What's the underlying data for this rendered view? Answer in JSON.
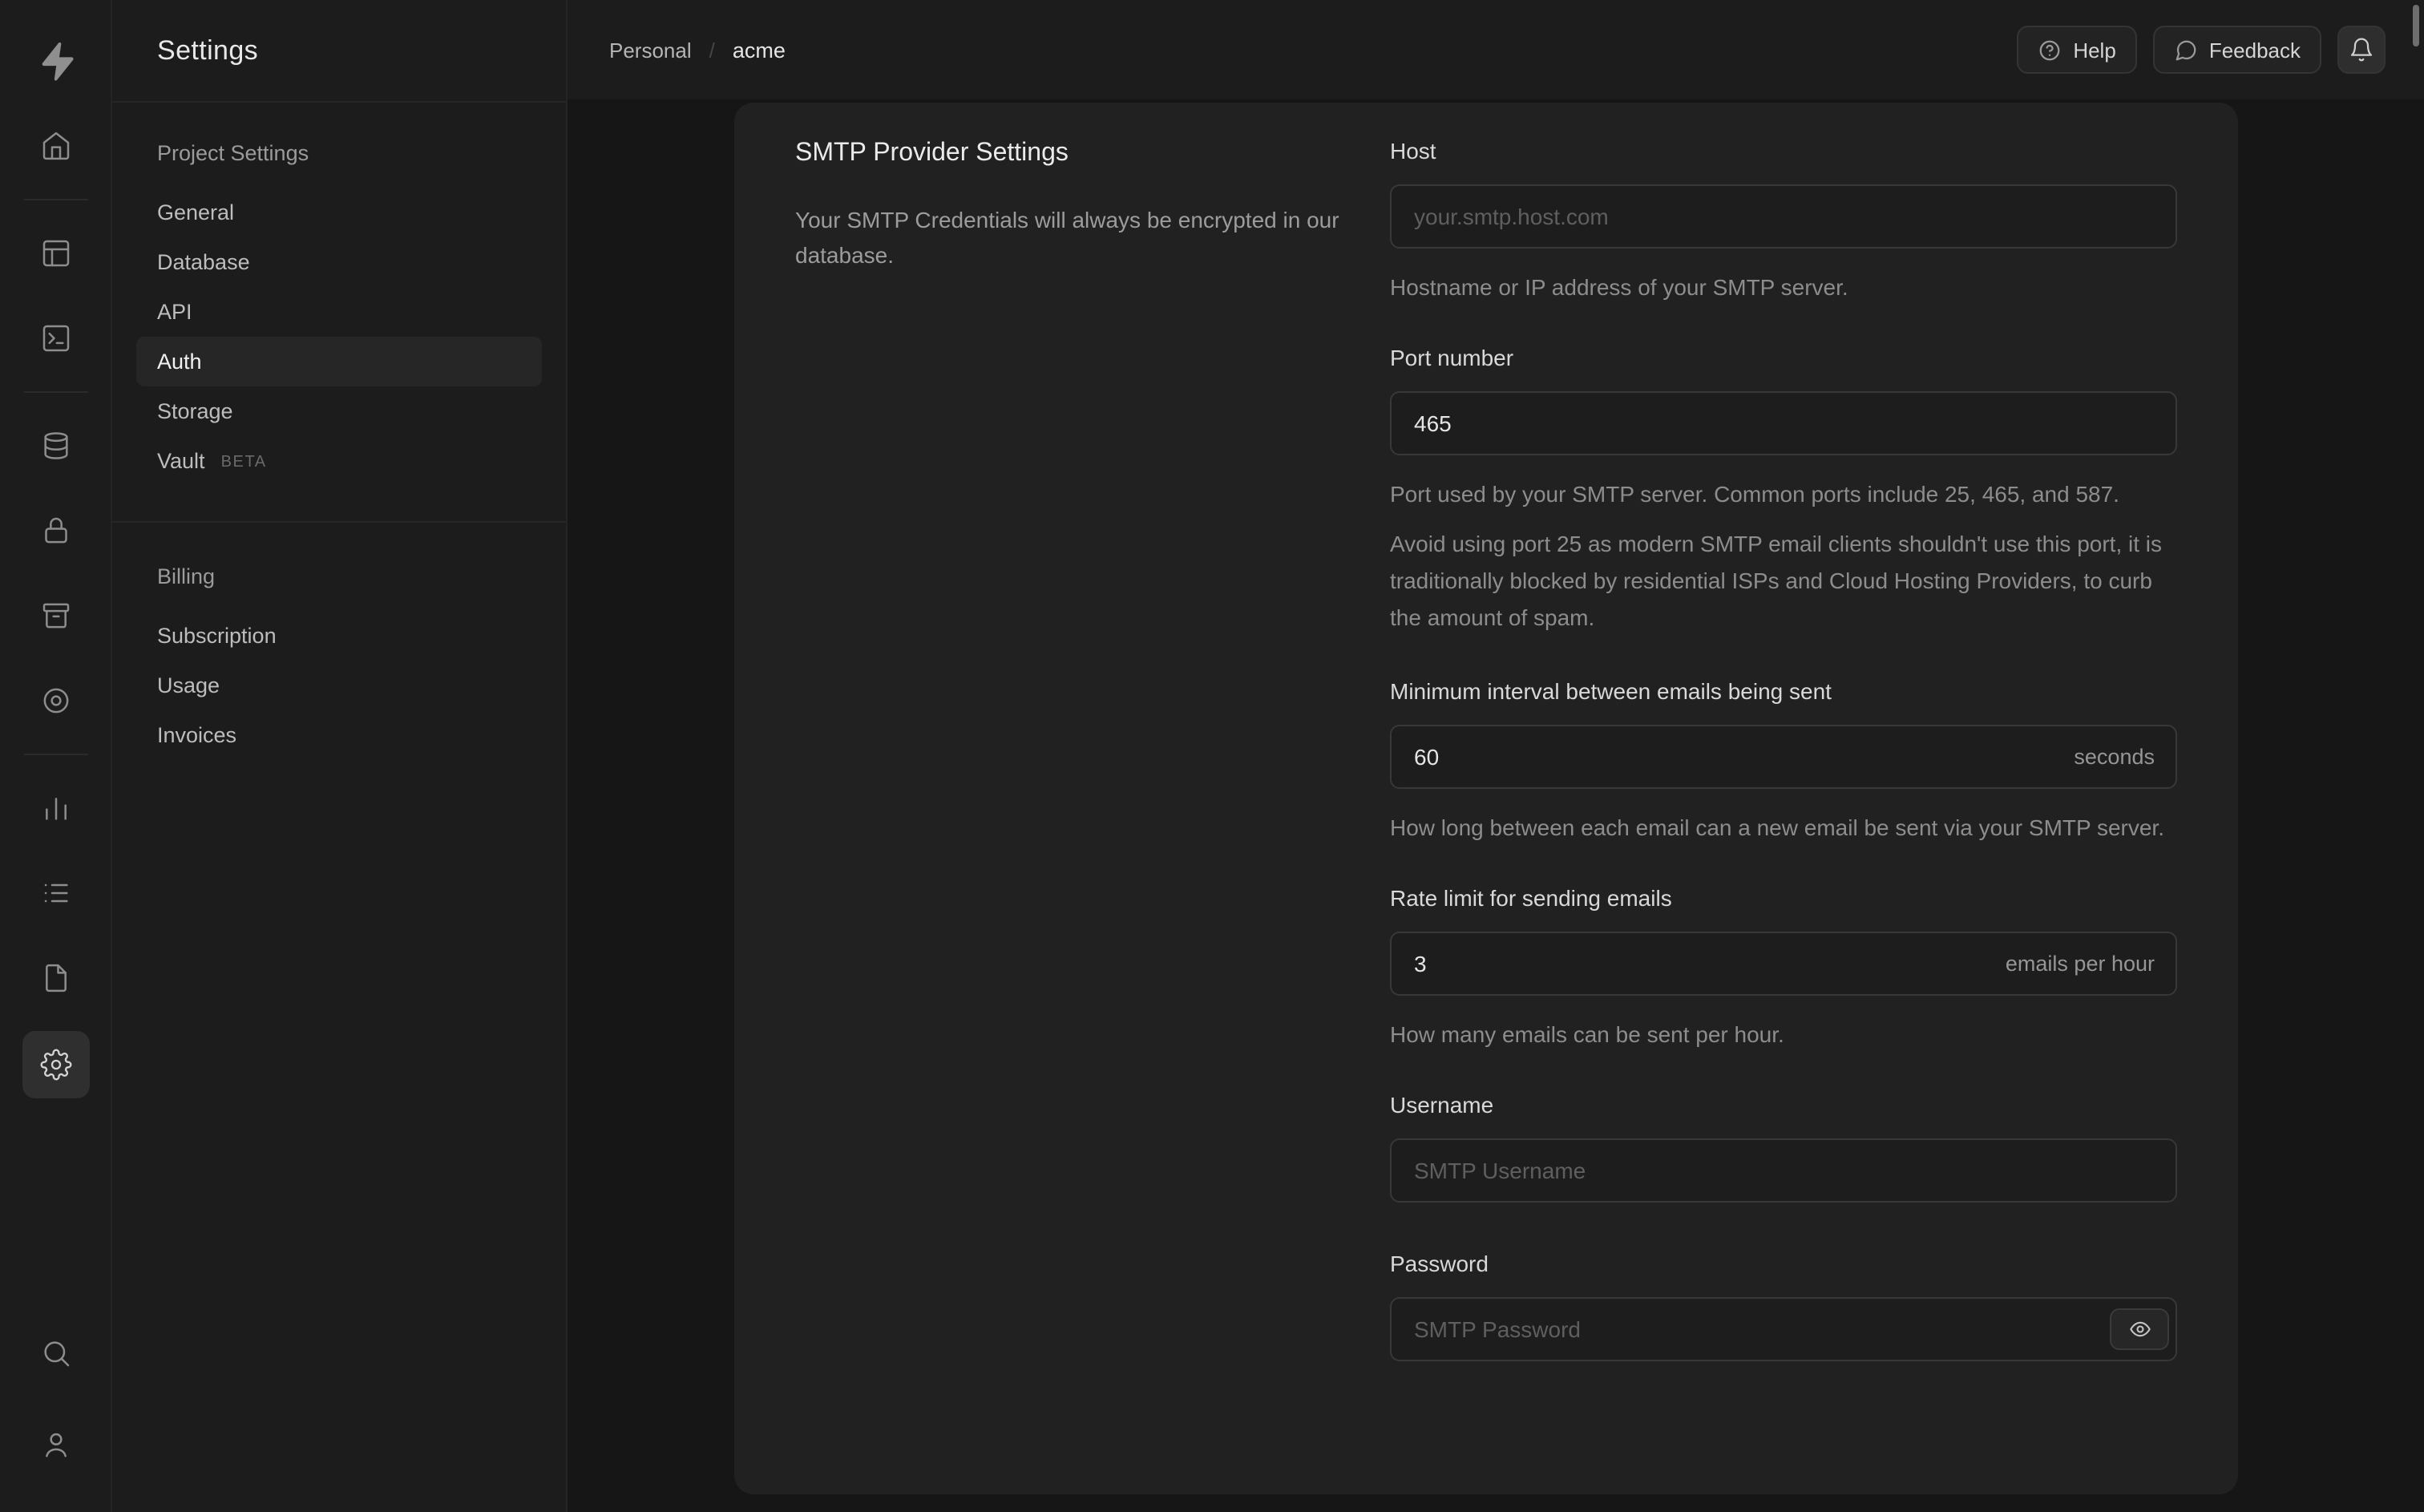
{
  "theme": {
    "bg": "#1c1c1c",
    "content_bg": "#161616",
    "card_bg": "#212121",
    "border": "#2e2e2e",
    "text_primary": "#ededed",
    "text_muted": "#8d8d8d"
  },
  "icon_rail": {
    "icons": [
      "supabase-logo",
      "home",
      "table-editor",
      "sql-editor",
      "database",
      "authentication",
      "storage",
      "edge-functions",
      "reports",
      "logs",
      "docs",
      "project-settings",
      "search",
      "account"
    ]
  },
  "sidebar": {
    "title": "Settings",
    "sections": [
      {
        "label": "Project Settings",
        "items": [
          {
            "label": "General"
          },
          {
            "label": "Database"
          },
          {
            "label": "API"
          },
          {
            "label": "Auth",
            "active": true
          },
          {
            "label": "Storage"
          },
          {
            "label": "Vault",
            "badge": "BETA"
          }
        ]
      },
      {
        "label": "Billing",
        "items": [
          {
            "label": "Subscription"
          },
          {
            "label": "Usage"
          },
          {
            "label": "Invoices"
          }
        ]
      }
    ]
  },
  "header": {
    "breadcrumb": [
      "Personal",
      "acme"
    ],
    "separator": "/",
    "actions": {
      "help": "Help",
      "feedback": "Feedback"
    }
  },
  "panel": {
    "title": "SMTP Provider Settings",
    "description": "Your SMTP Credentials will always be encrypted in our database.",
    "fields": {
      "host": {
        "label": "Host",
        "placeholder": "your.smtp.host.com",
        "help": "Hostname or IP address of your SMTP server."
      },
      "port": {
        "label": "Port number",
        "value": "465",
        "help": "Port used by your SMTP server. Common ports include 25, 465, and 587.",
        "note": "Avoid using port 25 as modern SMTP email clients shouldn't use this port, it is traditionally blocked by residential ISPs and Cloud Hosting Providers, to curb the amount of spam."
      },
      "interval": {
        "label": "Minimum interval between emails being sent",
        "value": "60",
        "suffix": "seconds",
        "help": "How long between each email can a new email be sent via your SMTP server."
      },
      "rate": {
        "label": "Rate limit for sending emails",
        "value": "3",
        "suffix": "emails per hour",
        "help": "How many emails can be sent per hour."
      },
      "username": {
        "label": "Username",
        "placeholder": "SMTP Username"
      },
      "password": {
        "label": "Password",
        "placeholder": "SMTP Password"
      }
    }
  }
}
